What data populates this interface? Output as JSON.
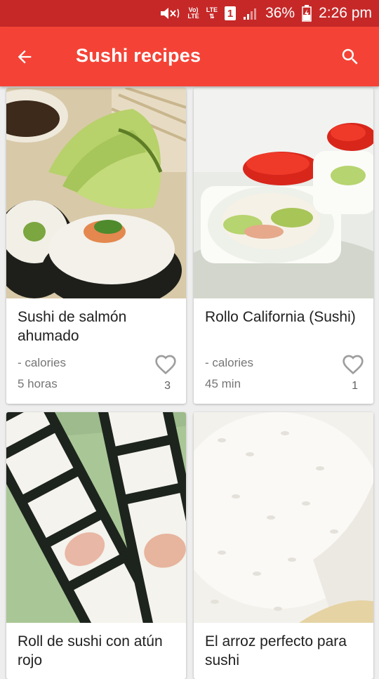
{
  "status_bar": {
    "volte": "Vo)",
    "lte_a": "LTE",
    "lte_b": "LTE",
    "sim": "1",
    "battery": "36%",
    "time": "2:26 pm"
  },
  "app_bar": {
    "title": "Sushi recipes",
    "back_icon": "arrow-back-icon",
    "search_icon": "search-icon"
  },
  "colors": {
    "status_bar": "#c62828",
    "app_bar": "#f44336"
  },
  "recipes": [
    {
      "name": "Sushi de salmón ahumado",
      "calories": "- calories",
      "time": "5 horas",
      "likes": "3"
    },
    {
      "name": "Rollo California (Sushi)",
      "calories": "- calories",
      "time": "45 min",
      "likes": "1"
    },
    {
      "name": "Roll de sushi con atún rojo"
    },
    {
      "name": "El arroz perfecto para sushi"
    }
  ]
}
